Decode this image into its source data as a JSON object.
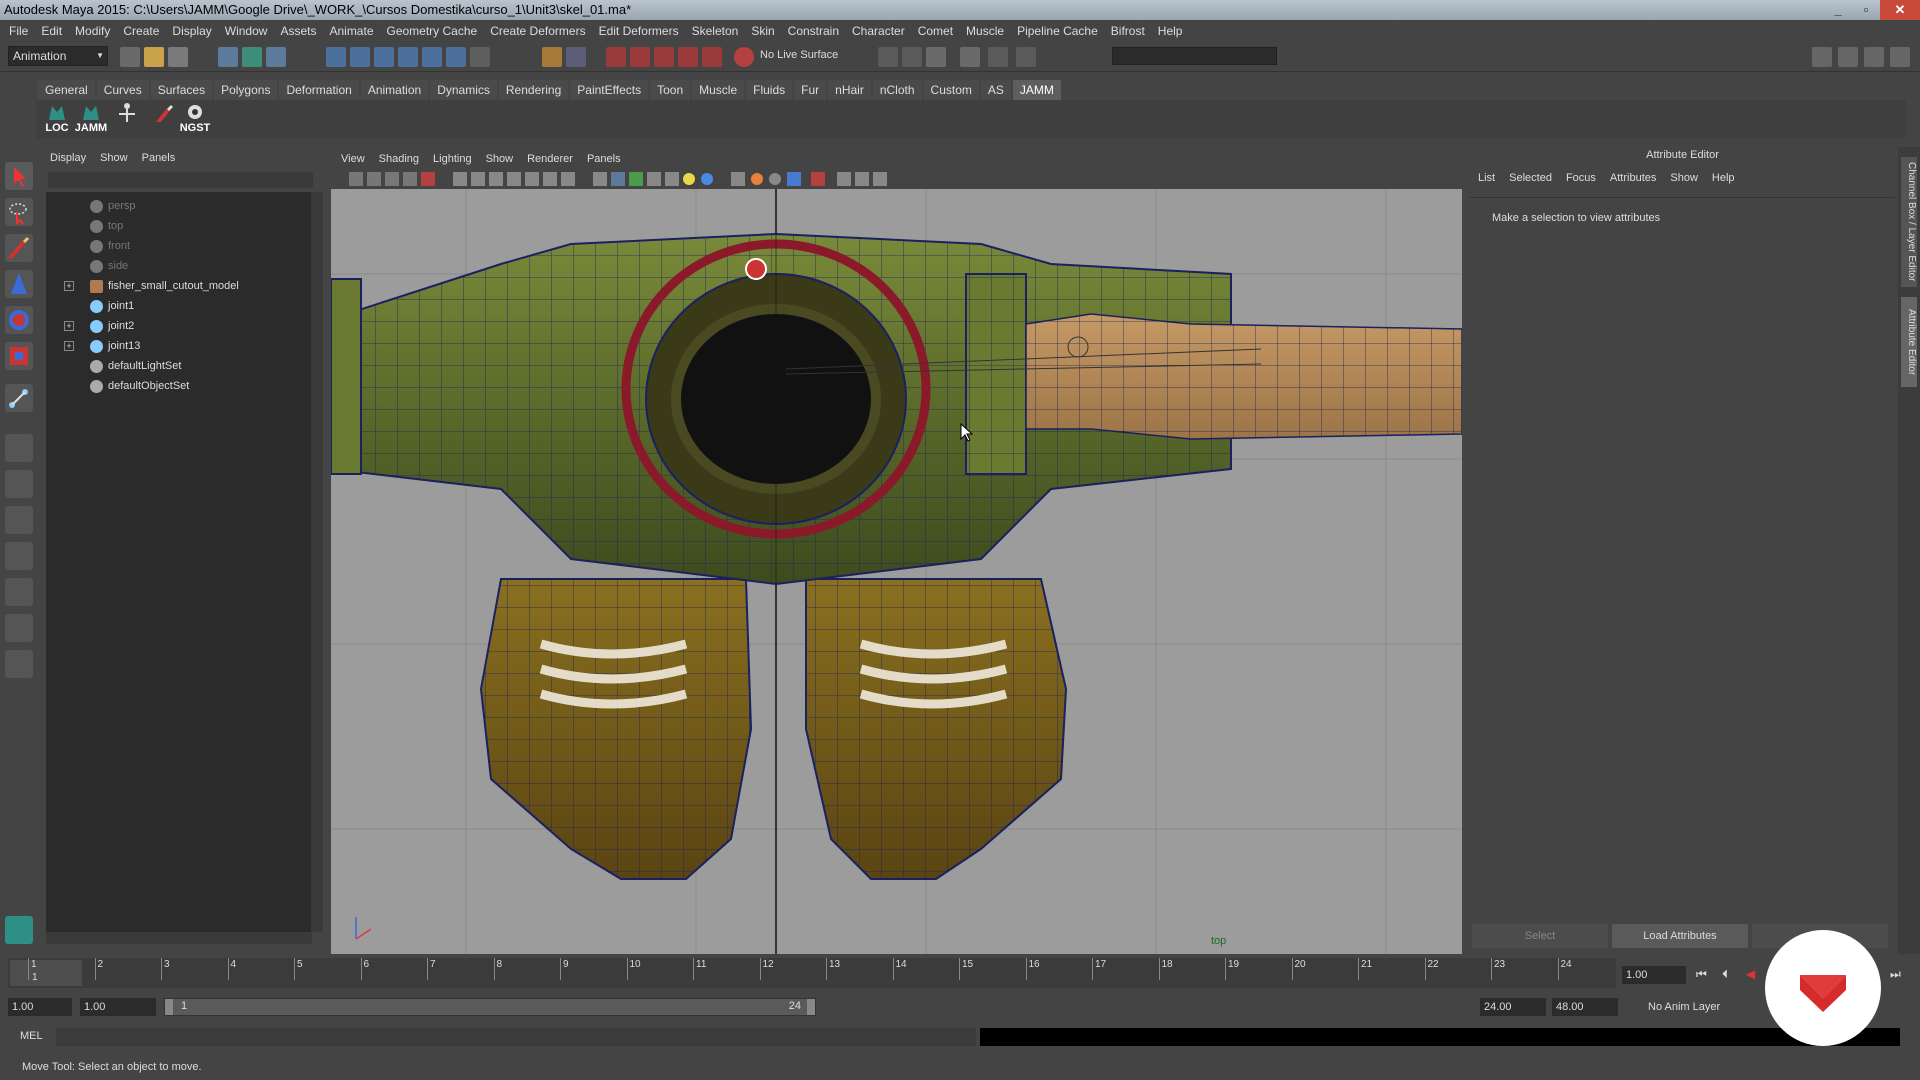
{
  "window": {
    "title": "Autodesk Maya 2015: C:\\Users\\JAMM\\Google Drive\\_WORK_\\Cursos Domestika\\curso_1\\Unit3\\skel_01.ma*",
    "controls": [
      "_",
      "▫",
      "✕"
    ]
  },
  "menubar": [
    "File",
    "Edit",
    "Modify",
    "Create",
    "Display",
    "Window",
    "Assets",
    "Animate",
    "Geometry Cache",
    "Create Deformers",
    "Edit Deformers",
    "Skeleton",
    "Skin",
    "Constrain",
    "Character",
    "Comet",
    "Muscle",
    "Pipeline Cache",
    "Bifrost",
    "Help"
  ],
  "statusline": {
    "mode": "Animation",
    "live_surface": "No Live Surface"
  },
  "shelf": {
    "tabs": [
      "General",
      "Curves",
      "Surfaces",
      "Polygons",
      "Deformation",
      "Animation",
      "Dynamics",
      "Rendering",
      "PaintEffects",
      "Toon",
      "Muscle",
      "Fluids",
      "Fur",
      "nHair",
      "nCloth",
      "Custom",
      "AS",
      "JAMM"
    ],
    "active_tab": "JAMM",
    "icons": [
      "LOC",
      "JAMM",
      "",
      "",
      "NGST"
    ]
  },
  "outliner": {
    "menu": [
      "Display",
      "Show",
      "Panels"
    ],
    "items": [
      {
        "label": "persp",
        "type": "camera",
        "expandable": false
      },
      {
        "label": "top",
        "type": "camera",
        "expandable": false
      },
      {
        "label": "front",
        "type": "camera",
        "expandable": false
      },
      {
        "label": "side",
        "type": "camera",
        "expandable": false
      },
      {
        "label": "fisher_small_cutout_model",
        "type": "mesh",
        "expandable": true
      },
      {
        "label": "joint1",
        "type": "joint",
        "expandable": false
      },
      {
        "label": "joint2",
        "type": "joint",
        "expandable": true
      },
      {
        "label": "joint13",
        "type": "joint",
        "expandable": true
      },
      {
        "label": "defaultLightSet",
        "type": "set",
        "expandable": false
      },
      {
        "label": "defaultObjectSet",
        "type": "set",
        "expandable": false
      }
    ]
  },
  "viewport": {
    "menu": [
      "View",
      "Shading",
      "Lighting",
      "Show",
      "Renderer",
      "Panels"
    ],
    "camera": "top"
  },
  "attribute_editor": {
    "title": "Attribute Editor",
    "menu": [
      "List",
      "Selected",
      "Focus",
      "Attributes",
      "Show",
      "Help"
    ],
    "message": "Make a selection to view attributes",
    "buttons": {
      "select": "Select",
      "load": "Load Attributes"
    }
  },
  "side_tabs": [
    "Channel Box / Layer Editor",
    "Attribute Editor"
  ],
  "timeline": {
    "ticks": [
      "1",
      "2",
      "3",
      "4",
      "5",
      "6",
      "7",
      "8",
      "9",
      "10",
      "11",
      "12",
      "13",
      "14",
      "15",
      "16",
      "17",
      "18",
      "19",
      "20",
      "21",
      "22",
      "23",
      "24"
    ],
    "current_frame_label": "1",
    "current_frame": "1.00"
  },
  "range": {
    "start": "1.00",
    "playback_start": "1.00",
    "slider_start": "1",
    "slider_end": "24",
    "playback_end": "24.00",
    "end": "48.00",
    "anim_layer": "No Anim Layer"
  },
  "cmdline": {
    "label": "MEL"
  },
  "helpline": "Move Tool: Select an object to move."
}
